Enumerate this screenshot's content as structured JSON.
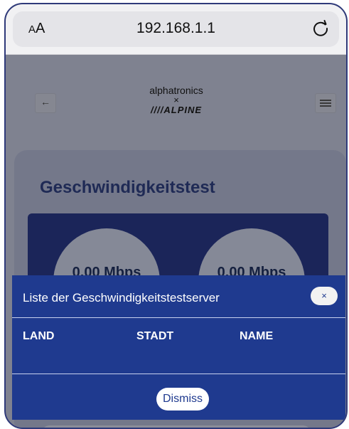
{
  "browser": {
    "text_size_label": "AA",
    "url": "192.168.1.1",
    "reload_icon": "reload-icon"
  },
  "header": {
    "back_icon": "←",
    "menu_icon": "hamburger-menu-icon",
    "logo": {
      "line1": "alphatronics",
      "cross": "×",
      "line2": "////ALPINE"
    }
  },
  "speedtest": {
    "title": "Geschwindigkeitstest",
    "download_value": "0.00 Mbps",
    "upload_value": "0.00 Mbps"
  },
  "modal": {
    "title": "Liste der Geschwindigkeitstestserver",
    "close_label": "×",
    "columns": [
      "LAND",
      "STADT",
      "NAME"
    ],
    "dismiss_label": "Dismiss"
  },
  "colors": {
    "modal_bg": "#1f3a8f",
    "panel_bg": "#1b2559",
    "title_color": "#1f2a55"
  }
}
